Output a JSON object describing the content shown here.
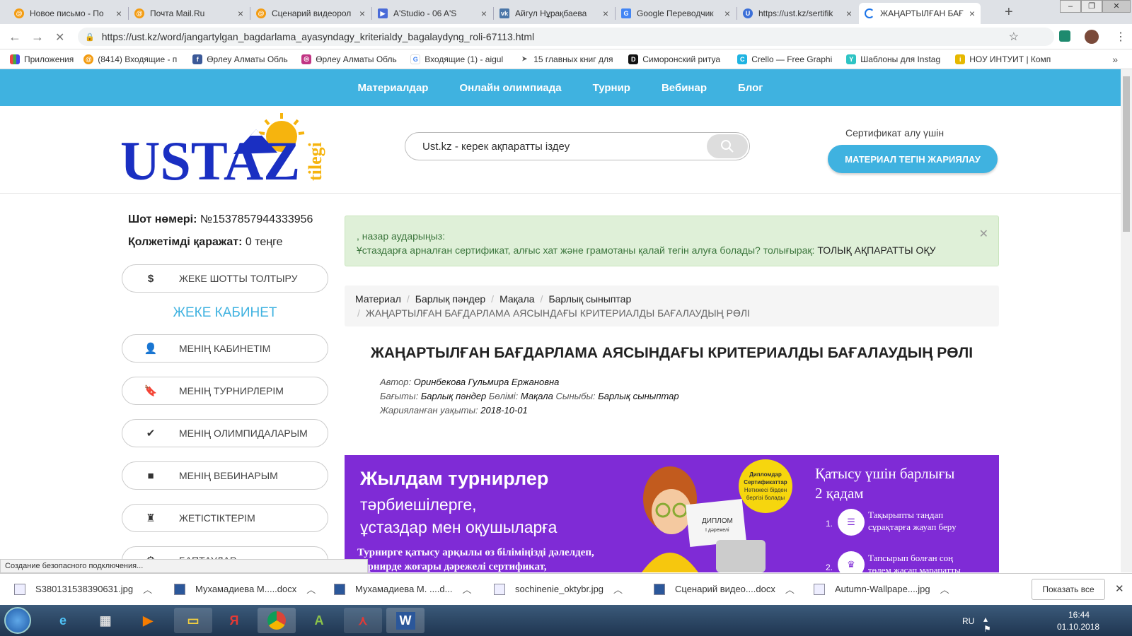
{
  "browser": {
    "tabs": [
      {
        "title": "Новое письмо - По",
        "icon": "mail-ru-icon"
      },
      {
        "title": "Почта Mail.Ru",
        "icon": "mail-ru-icon"
      },
      {
        "title": "Сценарий видеорол",
        "icon": "mail-ru-icon"
      },
      {
        "title": "A'Studio - 06 A'S",
        "icon": "youtube-icon"
      },
      {
        "title": "Айгул Нұрақбаева",
        "icon": "vk-icon"
      },
      {
        "title": "Google Переводчик",
        "icon": "google-translate-icon"
      },
      {
        "title": "https://ust.kz/sertifik",
        "icon": "ustaz-icon"
      },
      {
        "title": "ЖАҢАРТЫЛҒАН БАҒ",
        "icon": "loading-icon"
      }
    ],
    "url": "https://ust.kz/word/jangartylgan_bagdarlama_ayasyndagy_kriterialdy_bagalaydyng_roli-67113.html",
    "bookmarks": [
      {
        "label": "Приложения",
        "icon": "apps-grid-icon"
      },
      {
        "label": "(8414) Входящие - п",
        "icon": "mail-ru-icon"
      },
      {
        "label": "Өрлеу Алматы Обль",
        "icon": "facebook-icon"
      },
      {
        "label": "Өрлеу Алматы Обль",
        "icon": "instagram-icon"
      },
      {
        "label": "Входящие (1) - aigul",
        "icon": "google-icon"
      },
      {
        "label": "15 главных книг для",
        "icon": "telegram-icon"
      },
      {
        "label": "Симоронский ритуа",
        "icon": "d-icon"
      },
      {
        "label": "Crello — Free Graphi",
        "icon": "crello-icon"
      },
      {
        "label": "Шаблоны для Instag",
        "icon": "template-icon"
      },
      {
        "label": "НОУ ИНТУИТ | Комп",
        "icon": "intuit-icon"
      }
    ],
    "status": "Создание безопасного подключения..."
  },
  "site": {
    "nav": [
      "Материалдар",
      "Онлайн олимпиада",
      "Турнир",
      "Вебинар",
      "Блог"
    ],
    "logo": {
      "main": "USTAZ",
      "sub": "tilegi"
    },
    "search_placeholder": "Ust.kz - керек ақпаратты іздеу",
    "cert_label": "Сертификат алу үшін",
    "publish_button": "МАТЕРИАЛ ТЕГІН ЖАРИЯЛАУ"
  },
  "account": {
    "number_label": "Шот нөмері:",
    "number_value": "№1537857944333956",
    "balance_label": "Қолжетімді қаражат:",
    "balance_value": "0 теңге",
    "topup": "ЖЕКЕ ШОТТЫ ТОЛТЫРУ",
    "cabinet_title": "ЖЕКЕ КАБИНЕТ",
    "menu": [
      {
        "label": "МЕНІҢ КАБИНЕТІМ",
        "icon": "user-icon"
      },
      {
        "label": "МЕНІҢ ТУРНИРЛЕРІМ",
        "icon": "bookmark-icon"
      },
      {
        "label": "МЕНІҢ ОЛИМПИДАЛАРЫМ",
        "icon": "check-circle-icon"
      },
      {
        "label": "МЕНІҢ ВЕБИНАРЫМ",
        "icon": "video-camera-icon"
      },
      {
        "label": "ЖЕТІСТІКТЕРІМ",
        "icon": "chess-rook-icon"
      },
      {
        "label": "БАПТАУЛАР",
        "icon": "gear-icon"
      }
    ]
  },
  "alert": {
    "line1": ", назар аударыңыз:",
    "line2": "Ұстаздарға арналған сертификат, алғыс хат және грамотаны қалай тегін алуға болады? толығырақ:",
    "link": "ТОЛЫҚ АҚПАРАТТЫ ОҚУ"
  },
  "breadcrumbs": [
    "Материал",
    "Барлық пәндер",
    "Мақала",
    "Барлық сыныптар",
    "ЖАҢАРТЫЛҒАН БАҒДАРЛАМА АЯСЫНДАҒЫ КРИТЕРИАЛДЫ БАҒАЛАУДЫҢ РӨЛІ"
  ],
  "article": {
    "title": "ЖАҢАРТЫЛҒАН БАҒДАРЛАМА АЯСЫНДАҒЫ КРИТЕРИАЛДЫ БАҒАЛАУДЫҢ РӨЛІ",
    "author_label": "Автор:",
    "author": "Оринбекова Гульмира Ержановна",
    "direction_label": "Бағыты:",
    "direction": "Барлық пәндер",
    "section_label": "Бөлімі:",
    "section": "Мақала",
    "grade_label": "Сыныбы:",
    "grade": "Барлық сыныптар",
    "published_label": "Жарияланған уақыты:",
    "published": "2018-10-01"
  },
  "banner": {
    "title": "Жылдам турнирлер",
    "subtitle1": "тәрбиешілерге,",
    "subtitle2": "ұстаздар мен оқушыларға",
    "body1": "Турнирге қатысу арқылы өз біліміңізді дәлелдеп,",
    "body2": "турнирде жоғары дәрежелі сертификат,",
    "right1": "Қатысу үшін барлығы",
    "right2": "2 қадам",
    "step1a": "Тақырыпты таңдап",
    "step1b": "сұрақтарға жауап беру",
    "step2a": "Тапсырып болған соң",
    "step2b": "төлем жасап марапатты",
    "badge1": "Дипломдар",
    "badge2": "Сертификаттар",
    "badge3": "Нәтижесі бірден",
    "badge4": "бергізі болады",
    "diploma1": "ДИПЛОМ",
    "diploma2": "I дәрежелі"
  },
  "downloads": [
    "S380131538390631.jpg",
    "Мухамадиева М.....docx",
    "Мухамадиева М.  ....d...",
    "sochinenie_oktybr.jpg",
    "Сценарий видео....docx",
    "Autumn-Wallpape....jpg"
  ],
  "show_all": "Показать все",
  "tray": {
    "lang": "RU",
    "time": "16:44",
    "date": "01.10.2018"
  },
  "colors": {
    "accent": "#3fb2e0",
    "banner": "#7f2bd6",
    "alert_bg": "#dff0d8",
    "alert_text": "#3c763d",
    "logo": "#1a2fc2",
    "logo_sub": "#f6b40e"
  }
}
